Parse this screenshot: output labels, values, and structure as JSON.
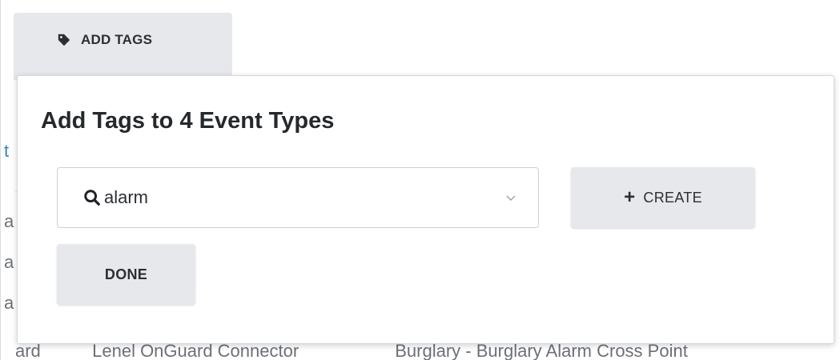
{
  "toolbar": {
    "add_tags_label": "ADD TAGS"
  },
  "background": {
    "left_fragments": [
      "t",
      "a",
      "a",
      "a"
    ],
    "bottom_row": [
      "ard",
      "Lenel OnGuard Connector",
      "Burglary - Burglary Alarm Cross Point"
    ]
  },
  "dialog": {
    "title": "Add Tags to 4 Event Types",
    "search": {
      "value": "alarm"
    },
    "create_label": "CREATE",
    "done_label": "DONE"
  },
  "colors": {
    "button_bg": "#e6e8eb",
    "text": "#2b2f33",
    "border": "#ccd0d5"
  },
  "icons": [
    "tag-icon",
    "search-icon",
    "chevron-down-icon",
    "plus-icon"
  ]
}
